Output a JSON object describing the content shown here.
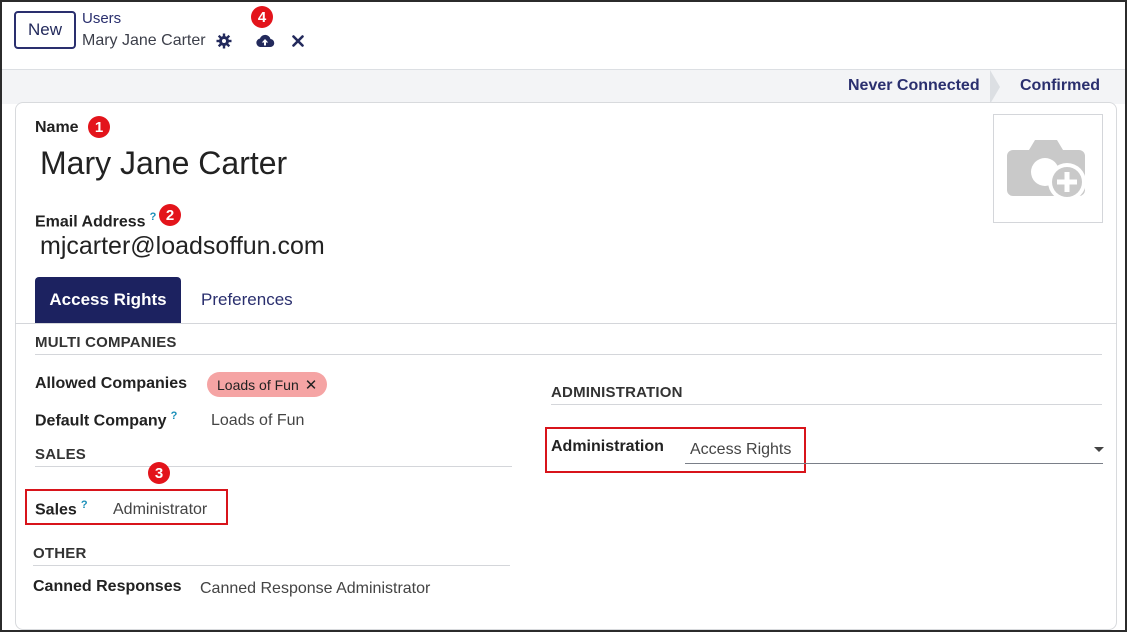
{
  "control_panel": {
    "new_label": "New",
    "breadcrumb_parent": "Users",
    "breadcrumb_current": "Mary Jane Carter",
    "icons": [
      "gear-icon",
      "cloud-upload-icon",
      "close-icon"
    ]
  },
  "status_bar": {
    "stages": [
      "Never Connected",
      "Confirmed"
    ]
  },
  "markers": [
    "1",
    "2",
    "3",
    "4"
  ],
  "form": {
    "name_label": "Name",
    "name_value": "Mary Jane Carter",
    "email_label": "Email Address",
    "email_help": "?",
    "email_value": "mjcarter@loadsoffun.com"
  },
  "tabs": [
    {
      "label": "Access Rights",
      "active": true
    },
    {
      "label": "Preferences",
      "active": false
    }
  ],
  "multi_companies": {
    "title": "MULTI COMPANIES",
    "allowed_label": "Allowed Companies",
    "allowed_tag": "Loads of Fun",
    "tag_remove": "✕",
    "default_label": "Default Company",
    "default_help": "?",
    "default_value": "Loads of Fun"
  },
  "sales": {
    "title": "SALES",
    "label": "Sales",
    "help": "?",
    "value": "Administrator"
  },
  "other": {
    "title": "OTHER",
    "label": "Canned Responses",
    "value": "Canned Response Administrator"
  },
  "administration": {
    "title": "ADMINISTRATION",
    "label": "Administration",
    "value": "Access Rights"
  },
  "colors": {
    "brand": "#1c2260",
    "marker": "#e3141b",
    "tag": "#f5a4a4",
    "help": "#1a8fb8"
  }
}
